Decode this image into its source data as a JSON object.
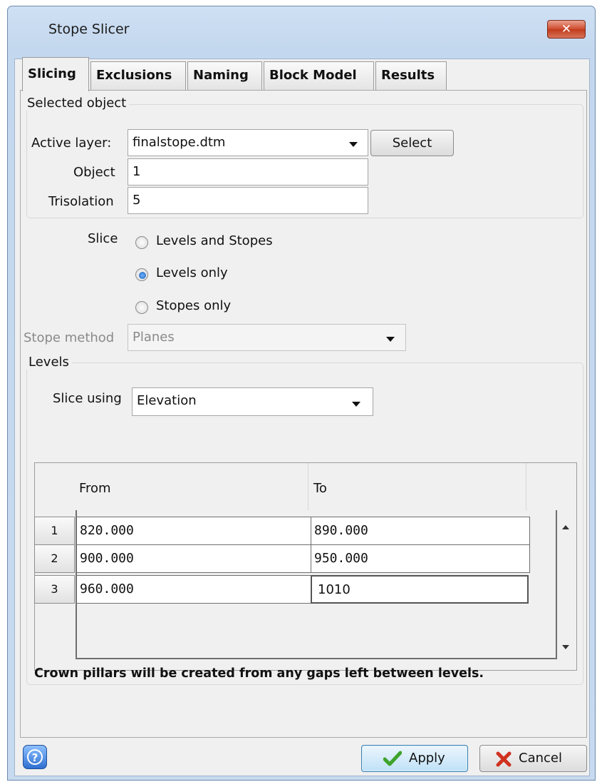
{
  "window": {
    "title": "Stope Slicer",
    "close_glyph": "✕"
  },
  "tabs": [
    {
      "label": "Slicing",
      "active": true
    },
    {
      "label": "Exclusions",
      "active": false
    },
    {
      "label": "Naming",
      "active": false
    },
    {
      "label": "Block Model",
      "active": false
    },
    {
      "label": "Results",
      "active": false
    }
  ],
  "selected_object": {
    "group_label": "Selected object",
    "active_layer_label": "Active layer:",
    "active_layer_value": "finalstope.dtm",
    "select_button": "Select",
    "object_label": "Object",
    "object_value": "1",
    "trisolation_label": "Trisolation",
    "trisolation_value": "5"
  },
  "slice": {
    "label": "Slice",
    "options": [
      {
        "label": "Levels and Stopes",
        "selected": false
      },
      {
        "label": "Levels only",
        "selected": true
      },
      {
        "label": "Stopes only",
        "selected": false
      }
    ]
  },
  "stope_method": {
    "label": "Stope method",
    "value": "Planes",
    "enabled": false
  },
  "levels": {
    "group_label": "Levels",
    "slice_using_label": "Slice using",
    "slice_using_value": "Elevation",
    "columns": [
      "From",
      "To"
    ],
    "rows": [
      {
        "num": "1",
        "from": "820.000",
        "to": "890.000"
      },
      {
        "num": "2",
        "from": "900.000",
        "to": "950.000"
      },
      {
        "num": "3",
        "from": "960.000",
        "to": "1010"
      }
    ],
    "note": "Crown pillars will be created from any gaps left between levels."
  },
  "footer": {
    "help_glyph": "?",
    "apply_label": "Apply",
    "cancel_label": "Cancel"
  },
  "colors": {
    "accent": "#3a7bd5",
    "apply_check": "#3fa32b",
    "cancel_x": "#d0311f"
  }
}
